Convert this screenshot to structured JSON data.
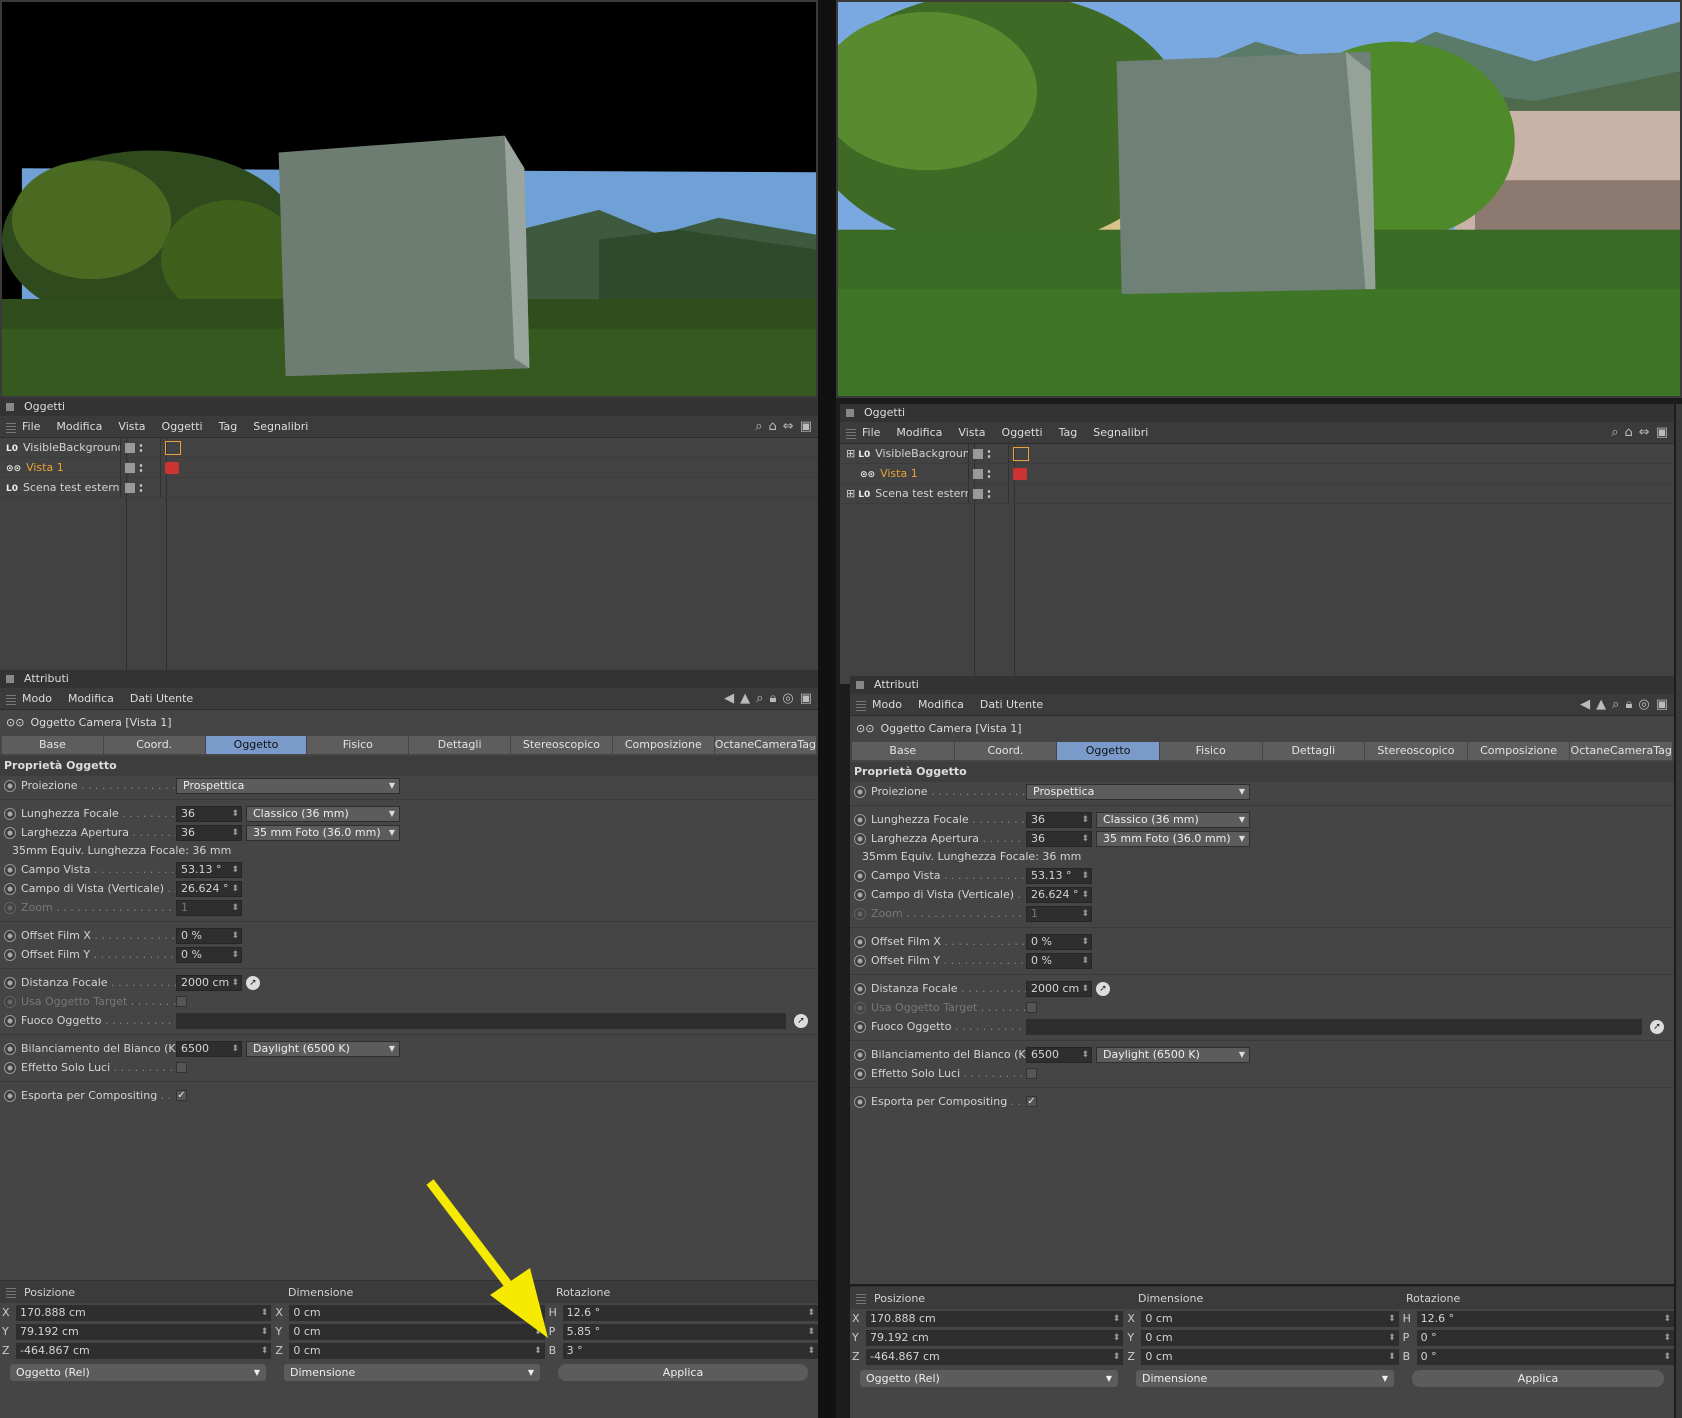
{
  "left": {
    "objects_title": "Oggetti",
    "obj_menu": [
      "File",
      "Modifica",
      "Vista",
      "Oggetti",
      "Tag",
      "Segnalibri"
    ],
    "objects": [
      {
        "name": "VisibleBackground",
        "color": "#d8d8d8",
        "prefix": "L0",
        "tag": "texture"
      },
      {
        "name": "Vista 1",
        "color": "#e8a33c",
        "prefix": "",
        "tag": "camera"
      },
      {
        "name": "Scena test esterni",
        "color": "#d8d8d8",
        "prefix": "L0",
        "tag": ""
      }
    ],
    "attr_title": "Attributi",
    "attr_menu": [
      "Modo",
      "Modifica",
      "Dati Utente"
    ],
    "object_header": "Oggetto Camera [Vista 1]",
    "tabs": [
      "Base",
      "Coord.",
      "Oggetto",
      "Fisico",
      "Dettagli",
      "Stereoscopico",
      "Composizione",
      "OctaneCameraTag"
    ],
    "active_tab": "Oggetto",
    "section": "Proprietà Oggetto",
    "props": {
      "proiezione": "Proiezione",
      "proiezione_val": "Prospettica",
      "lf": "Lunghezza Focale",
      "lf_val": "36",
      "lf_drop": "Classico (36 mm)",
      "la": "Larghezza Apertura",
      "la_val": "36",
      "la_drop": "35 mm Foto (36.0 mm)",
      "equiv": "35mm Equiv. Lunghezza Focale: 36 mm",
      "cv": "Campo Vista",
      "cv_val": "53.13 °",
      "cvv": "Campo di Vista (Verticale)",
      "cvv_val": "26.624 °",
      "zoom": "Zoom",
      "zoom_val": "1",
      "ofx": "Offset Film X",
      "ofx_val": "0 %",
      "ofy": "Offset Film Y",
      "ofy_val": "0 %",
      "df": "Distanza Focale",
      "df_val": "2000 cm",
      "uot": "Usa Oggetto Target",
      "fo": "Fuoco Oggetto",
      "bb": "Bilanciamento del Bianco (K)",
      "bb_val": "6500",
      "bb_drop": "Daylight (6500 K)",
      "esl": "Effetto Solo Luci",
      "epc": "Esporta per Compositing"
    },
    "coord": {
      "posizione": "Posizione",
      "dimensione": "Dimensione",
      "rotazione": "Rotazione",
      "x": "170.888 cm",
      "y": "79.192 cm",
      "z": "-464.867 cm",
      "dx": "0 cm",
      "dy": "0 cm",
      "dz": "0 cm",
      "h": "12.6 °",
      "p": "5.85 °",
      "b": "3 °",
      "mode": "Oggetto (Rel)",
      "dim_mode": "Dimensione",
      "apply": "Applica"
    }
  },
  "right": {
    "objects_title": "Oggetti",
    "obj_menu": [
      "File",
      "Modifica",
      "Vista",
      "Oggetti",
      "Tag",
      "Segnalibri"
    ],
    "objects": [
      {
        "name": "VisibleBackground",
        "color": "#d8d8d8",
        "prefix": "L0",
        "tag": "texture"
      },
      {
        "name": "Vista 1",
        "color": "#e8a33c",
        "prefix": "",
        "tag": "camera"
      },
      {
        "name": "Scena test esterni",
        "color": "#d8d8d8",
        "prefix": "L0",
        "tag": ""
      }
    ],
    "attr_title": "Attributi",
    "attr_menu": [
      "Modo",
      "Modifica",
      "Dati Utente"
    ],
    "object_header": "Oggetto Camera [Vista 1]",
    "tabs": [
      "Base",
      "Coord.",
      "Oggetto",
      "Fisico",
      "Dettagli",
      "Stereoscopico",
      "Composizione",
      "OctaneCameraTag"
    ],
    "active_tab": "Oggetto",
    "section": "Proprietà Oggetto",
    "props": {
      "proiezione": "Proiezione",
      "proiezione_val": "Prospettica",
      "lf": "Lunghezza Focale",
      "lf_val": "36",
      "lf_drop": "Classico (36 mm)",
      "la": "Larghezza Apertura",
      "la_val": "36",
      "la_drop": "35 mm Foto (36.0 mm)",
      "equiv": "35mm Equiv. Lunghezza Focale: 36 mm",
      "cv": "Campo Vista",
      "cv_val": "53.13 °",
      "cvv": "Campo di Vista (Verticale)",
      "cvv_val": "26.624 °",
      "zoom": "Zoom",
      "zoom_val": "1",
      "ofx": "Offset Film X",
      "ofx_val": "0 %",
      "ofy": "Offset Film Y",
      "ofy_val": "0 %",
      "df": "Distanza Focale",
      "df_val": "2000 cm",
      "uot": "Usa Oggetto Target",
      "fo": "Fuoco Oggetto",
      "bb": "Bilanciamento del Bianco (K)",
      "bb_val": "6500",
      "bb_drop": "Daylight (6500 K)",
      "esl": "Effetto Solo Luci",
      "epc": "Esporta per Compositing"
    },
    "coord": {
      "posizione": "Posizione",
      "dimensione": "Dimensione",
      "rotazione": "Rotazione",
      "x": "170.888 cm",
      "y": "79.192 cm",
      "z": "-464.867 cm",
      "dx": "0 cm",
      "dy": "0 cm",
      "dz": "0 cm",
      "h": "12.6 °",
      "p": "0 °",
      "b": "0 °",
      "mode": "Oggetto (Rel)",
      "dim_mode": "Dimensione",
      "apply": "Applica"
    }
  },
  "axes": {
    "x": "X",
    "y": "Y",
    "z": "Z",
    "h": "H",
    "p": "P",
    "b": "B"
  },
  "colors": {
    "accent_tab": "#7a9ac9",
    "arrow": "#f5ea00",
    "active_obj": "#e8a33c"
  }
}
